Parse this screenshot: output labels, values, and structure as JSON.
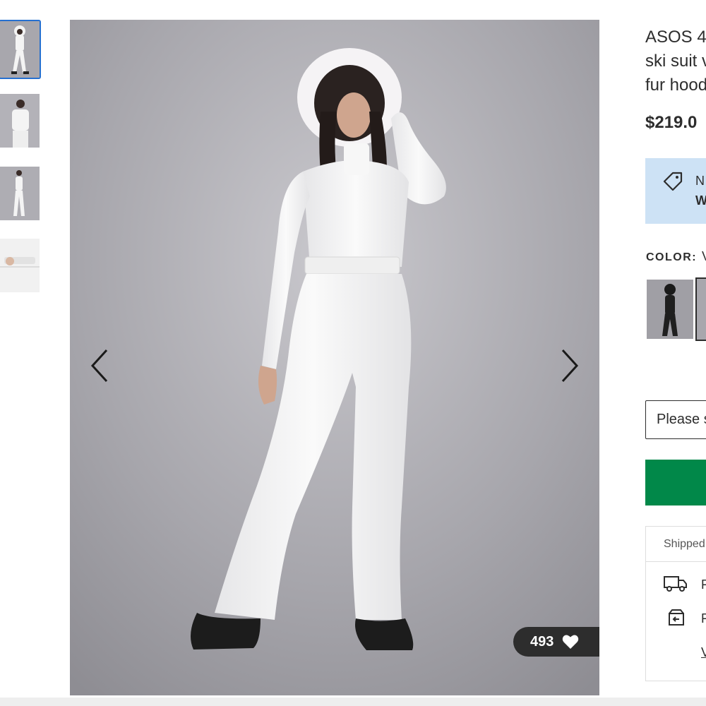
{
  "product": {
    "title_lines": [
      "ASOS 4",
      "ski suit v",
      "fur hood"
    ],
    "price": "$219.0"
  },
  "promo": {
    "line1": "N",
    "line2": "W"
  },
  "color": {
    "label": "COLOR:",
    "value": "V"
  },
  "size_select": {
    "placeholder": "Please s"
  },
  "gallery": {
    "likes_count": "493"
  },
  "shipping": {
    "header": "Shipped",
    "line1": "F",
    "line2": "F",
    "line3": "V"
  },
  "colors": {
    "accent_blue": "#2670d0",
    "add_green": "#018849",
    "promo_bg": "#cde2f5"
  },
  "icons": [
    "prev-arrow-icon",
    "next-arrow-icon",
    "heart-icon",
    "tag-icon",
    "truck-icon",
    "return-box-icon"
  ]
}
